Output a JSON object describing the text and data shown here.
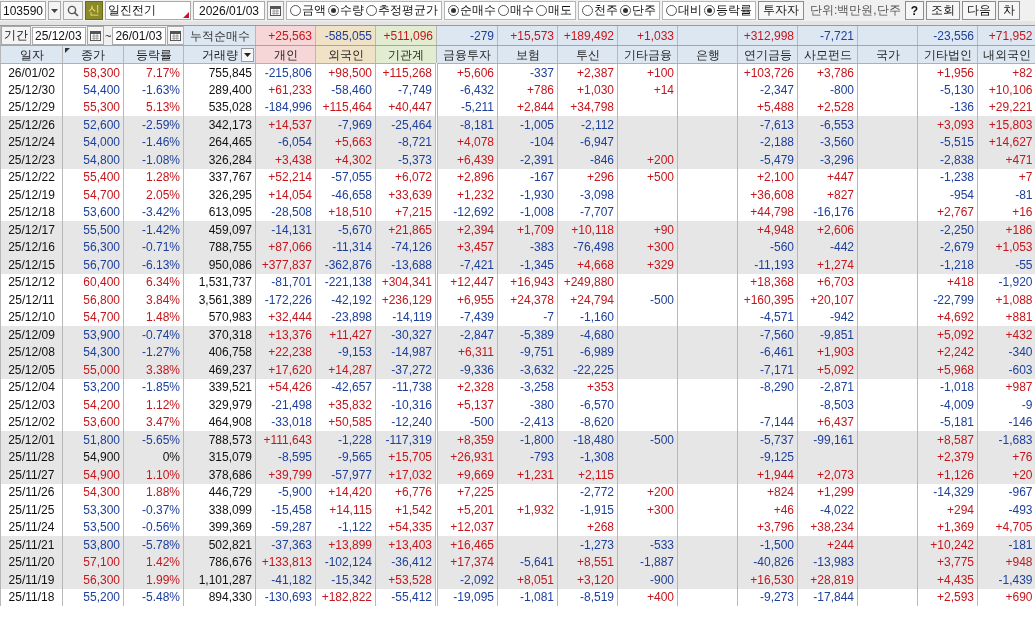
{
  "toolbar": {
    "code": "103590",
    "badge": "신",
    "name": "일진전기",
    "date": "2026/01/03",
    "radio_groups": [
      {
        "options": [
          {
            "label": "금액",
            "selected": false
          },
          {
            "label": "수량",
            "selected": true
          },
          {
            "label": "추정평균가",
            "selected": false
          }
        ]
      },
      {
        "options": [
          {
            "label": "순매수",
            "selected": true
          },
          {
            "label": "매수",
            "selected": false
          },
          {
            "label": "매도",
            "selected": false
          }
        ]
      },
      {
        "options": [
          {
            "label": "천주",
            "selected": false
          },
          {
            "label": "단주",
            "selected": true
          }
        ]
      },
      {
        "options": [
          {
            "label": "대비",
            "selected": false
          },
          {
            "label": "등락률",
            "selected": true
          }
        ]
      }
    ],
    "investor_button": "투자자",
    "unit": "단위:백만원,단주",
    "buttons": [
      "?",
      "조회",
      "다음",
      "차"
    ]
  },
  "summary": {
    "period_label": "기간",
    "from": "25/12/03",
    "separator": "~",
    "to": "26/01/03",
    "label": "누적순매수",
    "totals": {
      "individual": "+25,563",
      "foreign": "-585,055",
      "institution_total": "+511,096",
      "financial_investment": "-279",
      "insurance": "+15,573",
      "investment_trust": "+189,492",
      "other_finance": "+1,033",
      "pension_fund": "+312,998",
      "private_fund": "-7,721",
      "other_corporation": "-23,556",
      "domestic_foreign": "+71,952"
    }
  },
  "table": {
    "columns": [
      {
        "label": "일자"
      },
      {
        "label": "종가",
        "corner_mark": true
      },
      {
        "label": "등락률"
      },
      {
        "label": "거래량",
        "dropdown": true
      },
      {
        "label": "개인",
        "color": "#f6d6d6"
      },
      {
        "label": "외국인",
        "color": "#f0e2c6"
      },
      {
        "label": "기관계",
        "color": "#e2ecd0"
      },
      {
        "label": "금융투자"
      },
      {
        "label": "보험"
      },
      {
        "label": "투신"
      },
      {
        "label": "기타금융"
      },
      {
        "label": "은행"
      },
      {
        "label": "연기금등"
      },
      {
        "label": "사모펀드"
      },
      {
        "label": "국가"
      },
      {
        "label": "기타법인"
      },
      {
        "label": "내외국인"
      }
    ],
    "rows": [
      {
        "date": "26/01/02",
        "close": "58,300",
        "change": "7.17%",
        "volume": "755,845",
        "shaded": false,
        "net": {
          "individual": "-215,806",
          "foreign": "+98,500",
          "institution_total": "+115,268",
          "financial_investment": "+5,606",
          "insurance": "-337",
          "investment_trust": "+2,387",
          "other_finance": "+100",
          "pension_fund": "+103,726",
          "private_fund": "+3,786",
          "other_corporation": "+1,956",
          "domestic_foreign": "+82"
        }
      },
      {
        "date": "25/12/30",
        "close": "54,400",
        "change": "-1.63%",
        "volume": "289,400",
        "shaded": false,
        "net": {
          "individual": "+61,233",
          "foreign": "-58,460",
          "institution_total": "-7,749",
          "financial_investment": "-6,432",
          "insurance": "+786",
          "investment_trust": "+1,030",
          "other_finance": "+14",
          "pension_fund": "-2,347",
          "private_fund": "-800",
          "other_corporation": "-5,130",
          "domestic_foreign": "+10,106"
        }
      },
      {
        "date": "25/12/29",
        "close": "55,300",
        "change": "5.13%",
        "volume": "535,028",
        "shaded": false,
        "net": {
          "individual": "-184,996",
          "foreign": "+115,464",
          "institution_total": "+40,447",
          "financial_investment": "-5,211",
          "insurance": "+2,844",
          "investment_trust": "+34,798",
          "pension_fund": "+5,488",
          "private_fund": "+2,528",
          "other_corporation": "-136",
          "domestic_foreign": "+29,221"
        }
      },
      {
        "date": "25/12/26",
        "close": "52,600",
        "change": "-2.59%",
        "volume": "342,173",
        "shaded": true,
        "net": {
          "individual": "+14,537",
          "foreign": "-7,969",
          "institution_total": "-25,464",
          "financial_investment": "-8,181",
          "insurance": "-1,005",
          "investment_trust": "-2,112",
          "pension_fund": "-7,613",
          "private_fund": "-6,553",
          "other_corporation": "+3,093",
          "domestic_foreign": "+15,803"
        }
      },
      {
        "date": "25/12/24",
        "close": "54,000",
        "change": "-1.46%",
        "volume": "264,465",
        "shaded": true,
        "net": {
          "individual": "-6,054",
          "foreign": "+5,663",
          "institution_total": "-8,721",
          "financial_investment": "+4,078",
          "insurance": "-104",
          "investment_trust": "-6,947",
          "pension_fund": "-2,188",
          "private_fund": "-3,560",
          "other_corporation": "-5,515",
          "domestic_foreign": "+14,627"
        }
      },
      {
        "date": "25/12/23",
        "close": "54,800",
        "change": "-1.08%",
        "volume": "326,284",
        "shaded": true,
        "net": {
          "individual": "+3,438",
          "foreign": "+4,302",
          "institution_total": "-5,373",
          "financial_investment": "+6,439",
          "insurance": "-2,391",
          "investment_trust": "-846",
          "other_finance": "+200",
          "pension_fund": "-5,479",
          "private_fund": "-3,296",
          "other_corporation": "-2,838",
          "domestic_foreign": "+471"
        }
      },
      {
        "date": "25/12/22",
        "close": "55,400",
        "change": "1.28%",
        "volume": "337,767",
        "shaded": false,
        "net": {
          "individual": "+52,214",
          "foreign": "-57,055",
          "institution_total": "+6,072",
          "financial_investment": "+2,896",
          "insurance": "-167",
          "investment_trust": "+296",
          "other_finance": "+500",
          "pension_fund": "+2,100",
          "private_fund": "+447",
          "other_corporation": "-1,238",
          "domestic_foreign": "+7"
        }
      },
      {
        "date": "25/12/19",
        "close": "54,700",
        "change": "2.05%",
        "volume": "326,295",
        "shaded": false,
        "net": {
          "individual": "+14,054",
          "foreign": "-46,658",
          "institution_total": "+33,639",
          "financial_investment": "+1,232",
          "insurance": "-1,930",
          "investment_trust": "-3,098",
          "pension_fund": "+36,608",
          "private_fund": "+827",
          "other_corporation": "-954",
          "domestic_foreign": "-81"
        }
      },
      {
        "date": "25/12/18",
        "close": "53,600",
        "change": "-3.42%",
        "volume": "613,095",
        "shaded": false,
        "net": {
          "individual": "-28,508",
          "foreign": "+18,510",
          "institution_total": "+7,215",
          "financial_investment": "-12,692",
          "insurance": "-1,008",
          "investment_trust": "-7,707",
          "pension_fund": "+44,798",
          "private_fund": "-16,176",
          "other_corporation": "+2,767",
          "domestic_foreign": "+16"
        }
      },
      {
        "date": "25/12/17",
        "close": "55,500",
        "change": "-1.42%",
        "volume": "459,097",
        "shaded": true,
        "net": {
          "individual": "-14,131",
          "foreign": "-5,670",
          "institution_total": "+21,865",
          "financial_investment": "+2,394",
          "insurance": "+1,709",
          "investment_trust": "+10,118",
          "other_finance": "+90",
          "pension_fund": "+4,948",
          "private_fund": "+2,606",
          "other_corporation": "-2,250",
          "domestic_foreign": "+186"
        }
      },
      {
        "date": "25/12/16",
        "close": "56,300",
        "change": "-0.71%",
        "volume": "788,755",
        "shaded": true,
        "net": {
          "individual": "+87,066",
          "foreign": "-11,314",
          "institution_total": "-74,126",
          "financial_investment": "+3,457",
          "insurance": "-383",
          "investment_trust": "-76,498",
          "other_finance": "+300",
          "pension_fund": "-560",
          "private_fund": "-442",
          "other_corporation": "-2,679",
          "domestic_foreign": "+1,053"
        }
      },
      {
        "date": "25/12/15",
        "close": "56,700",
        "change": "-6.13%",
        "volume": "950,086",
        "shaded": true,
        "net": {
          "individual": "+377,837",
          "foreign": "-362,876",
          "institution_total": "-13,688",
          "financial_investment": "-7,421",
          "insurance": "-1,345",
          "investment_trust": "+4,668",
          "other_finance": "+329",
          "pension_fund": "-11,193",
          "private_fund": "+1,274",
          "other_corporation": "-1,218",
          "domestic_foreign": "-55"
        }
      },
      {
        "date": "25/12/12",
        "close": "60,400",
        "change": "6.34%",
        "volume": "1,531,737",
        "shaded": false,
        "net": {
          "individual": "-81,701",
          "foreign": "-221,138",
          "institution_total": "+304,341",
          "financial_investment": "+12,447",
          "insurance": "+16,943",
          "investment_trust": "+249,880",
          "pension_fund": "+18,368",
          "private_fund": "+6,703",
          "other_corporation": "+418",
          "domestic_foreign": "-1,920"
        }
      },
      {
        "date": "25/12/11",
        "close": "56,800",
        "change": "3.84%",
        "volume": "3,561,389",
        "shaded": false,
        "net": {
          "individual": "-172,226",
          "foreign": "-42,192",
          "institution_total": "+236,129",
          "financial_investment": "+6,955",
          "insurance": "+24,378",
          "investment_trust": "+24,794",
          "other_finance": "-500",
          "pension_fund": "+160,395",
          "private_fund": "+20,107",
          "other_corporation": "-22,799",
          "domestic_foreign": "+1,088"
        }
      },
      {
        "date": "25/12/10",
        "close": "54,700",
        "change": "1.48%",
        "volume": "570,983",
        "shaded": false,
        "net": {
          "individual": "+32,444",
          "foreign": "-23,898",
          "institution_total": "-14,119",
          "financial_investment": "-7,439",
          "insurance": "-7",
          "investment_trust": "-1,160",
          "pension_fund": "-4,571",
          "private_fund": "-942",
          "other_corporation": "+4,692",
          "domestic_foreign": "+881"
        }
      },
      {
        "date": "25/12/09",
        "close": "53,900",
        "change": "-0.74%",
        "volume": "370,318",
        "shaded": true,
        "net": {
          "individual": "+13,376",
          "foreign": "+11,427",
          "institution_total": "-30,327",
          "financial_investment": "-2,847",
          "insurance": "-5,389",
          "investment_trust": "-4,680",
          "pension_fund": "-7,560",
          "private_fund": "-9,851",
          "other_corporation": "+5,092",
          "domestic_foreign": "+432"
        }
      },
      {
        "date": "25/12/08",
        "close": "54,300",
        "change": "-1.27%",
        "volume": "406,758",
        "shaded": true,
        "net": {
          "individual": "+22,238",
          "foreign": "-9,153",
          "institution_total": "-14,987",
          "financial_investment": "+6,311",
          "insurance": "-9,751",
          "investment_trust": "-6,989",
          "pension_fund": "-6,461",
          "private_fund": "+1,903",
          "other_corporation": "+2,242",
          "domestic_foreign": "-340"
        }
      },
      {
        "date": "25/12/05",
        "close": "55,000",
        "change": "3.38%",
        "volume": "469,237",
        "shaded": true,
        "net": {
          "individual": "+17,620",
          "foreign": "+14,287",
          "institution_total": "-37,272",
          "financial_investment": "-9,336",
          "insurance": "-3,632",
          "investment_trust": "-22,225",
          "pension_fund": "-7,171",
          "private_fund": "+5,092",
          "other_corporation": "+5,968",
          "domestic_foreign": "-603"
        }
      },
      {
        "date": "25/12/04",
        "close": "53,200",
        "change": "-1.85%",
        "volume": "339,521",
        "shaded": false,
        "net": {
          "individual": "+54,426",
          "foreign": "-42,657",
          "institution_total": "-11,738",
          "financial_investment": "+2,328",
          "insurance": "-3,258",
          "investment_trust": "+353",
          "pension_fund": "-8,290",
          "private_fund": "-2,871",
          "other_corporation": "-1,018",
          "domestic_foreign": "+987"
        }
      },
      {
        "date": "25/12/03",
        "close": "54,200",
        "change": "1.12%",
        "volume": "329,979",
        "shaded": false,
        "net": {
          "individual": "-21,498",
          "foreign": "+35,832",
          "institution_total": "-10,316",
          "financial_investment": "+5,137",
          "insurance": "-380",
          "investment_trust": "-6,570",
          "private_fund": "-8,503",
          "other_corporation": "-4,009",
          "domestic_foreign": "-9"
        }
      },
      {
        "date": "25/12/02",
        "close": "53,600",
        "change": "3.47%",
        "volume": "464,908",
        "shaded": false,
        "net": {
          "individual": "-33,018",
          "foreign": "+50,585",
          "institution_total": "-12,240",
          "financial_investment": "-500",
          "insurance": "-2,413",
          "investment_trust": "-8,620",
          "pension_fund": "-7,144",
          "private_fund": "+6,437",
          "other_corporation": "-5,181",
          "domestic_foreign": "-146"
        }
      },
      {
        "date": "25/12/01",
        "close": "51,800",
        "change": "-5.65%",
        "volume": "788,573",
        "shaded": true,
        "net": {
          "individual": "+111,643",
          "foreign": "-1,228",
          "institution_total": "-117,319",
          "financial_investment": "+8,359",
          "insurance": "-1,800",
          "investment_trust": "-18,480",
          "other_finance": "-500",
          "pension_fund": "-5,737",
          "private_fund": "-99,161",
          "other_corporation": "+8,587",
          "domestic_foreign": "-1,683"
        }
      },
      {
        "date": "25/11/28",
        "close": "54,900",
        "change": "0%",
        "volume": "315,079",
        "shaded": true,
        "net": {
          "individual": "-8,595",
          "foreign": "-9,565",
          "institution_total": "+15,705",
          "financial_investment": "+26,931",
          "insurance": "-793",
          "investment_trust": "-1,308",
          "pension_fund": "-9,125",
          "other_corporation": "+2,379",
          "domestic_foreign": "+76"
        }
      },
      {
        "date": "25/11/27",
        "close": "54,900",
        "change": "1.10%",
        "volume": "378,686",
        "shaded": true,
        "net": {
          "individual": "+39,799",
          "foreign": "-57,977",
          "institution_total": "+17,032",
          "financial_investment": "+9,669",
          "insurance": "+1,231",
          "investment_trust": "+2,115",
          "pension_fund": "+1,944",
          "private_fund": "+2,073",
          "other_corporation": "+1,126",
          "domestic_foreign": "+20"
        }
      },
      {
        "date": "25/11/26",
        "close": "54,300",
        "change": "1.88%",
        "volume": "446,729",
        "shaded": false,
        "net": {
          "individual": "-5,900",
          "foreign": "+14,420",
          "institution_total": "+6,776",
          "financial_investment": "+7,225",
          "investment_trust": "-2,772",
          "other_finance": "+200",
          "pension_fund": "+824",
          "private_fund": "+1,299",
          "other_corporation": "-14,329",
          "domestic_foreign": "-967"
        }
      },
      {
        "date": "25/11/25",
        "close": "53,300",
        "change": "-0.37%",
        "volume": "338,099",
        "shaded": false,
        "net": {
          "individual": "-15,458",
          "foreign": "+14,115",
          "institution_total": "+1,542",
          "financial_investment": "+5,201",
          "insurance": "+1,932",
          "investment_trust": "-1,915",
          "other_finance": "+300",
          "pension_fund": "+46",
          "private_fund": "-4,022",
          "other_corporation": "+294",
          "domestic_foreign": "-493"
        }
      },
      {
        "date": "25/11/24",
        "close": "53,500",
        "change": "-0.56%",
        "volume": "399,369",
        "shaded": false,
        "net": {
          "individual": "-59,287",
          "foreign": "-1,122",
          "institution_total": "+54,335",
          "financial_investment": "+12,037",
          "investment_trust": "+268",
          "pension_fund": "+3,796",
          "private_fund": "+38,234",
          "other_corporation": "+1,369",
          "domestic_foreign": "+4,705"
        }
      },
      {
        "date": "25/11/21",
        "close": "53,800",
        "change": "-5.78%",
        "volume": "502,821",
        "shaded": true,
        "net": {
          "individual": "-37,363",
          "foreign": "+13,899",
          "institution_total": "+13,403",
          "financial_investment": "+16,465",
          "investment_trust": "-1,273",
          "other_finance": "-533",
          "pension_fund": "-1,500",
          "private_fund": "+244",
          "other_corporation": "+10,242",
          "domestic_foreign": "-181"
        }
      },
      {
        "date": "25/11/20",
        "close": "57,100",
        "change": "1.42%",
        "volume": "786,676",
        "shaded": true,
        "net": {
          "individual": "+133,813",
          "foreign": "-102,124",
          "institution_total": "-36,412",
          "financial_investment": "+17,374",
          "insurance": "-5,641",
          "investment_trust": "+8,551",
          "other_finance": "-1,887",
          "pension_fund": "-40,826",
          "private_fund": "-13,983",
          "other_corporation": "+3,775",
          "domestic_foreign": "+948"
        }
      },
      {
        "date": "25/11/19",
        "close": "56,300",
        "change": "1.99%",
        "volume": "1,101,287",
        "shaded": true,
        "net": {
          "individual": "-41,182",
          "foreign": "-15,342",
          "institution_total": "+53,528",
          "financial_investment": "-2,092",
          "insurance": "+8,051",
          "investment_trust": "+3,120",
          "other_finance": "-900",
          "pension_fund": "+16,530",
          "private_fund": "+28,819",
          "other_corporation": "+4,435",
          "domestic_foreign": "-1,439"
        }
      },
      {
        "date": "25/11/18",
        "close": "55,200",
        "change": "-5.48%",
        "volume": "894,330",
        "shaded": false,
        "net": {
          "individual": "-130,693",
          "foreign": "+182,822",
          "institution_total": "-55,412",
          "financial_investment": "-19,095",
          "insurance": "-1,081",
          "investment_trust": "-8,519",
          "other_finance": "+400",
          "pension_fund": "-9,273",
          "private_fund": "-17,844",
          "other_corporation": "+2,593",
          "domestic_foreign": "+690"
        }
      }
    ]
  }
}
